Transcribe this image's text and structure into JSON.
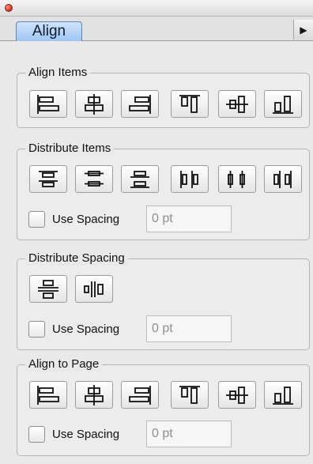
{
  "tab": {
    "label": "Align"
  },
  "panel_menu": {
    "label": "▶"
  },
  "align_items": {
    "title": "Align Items"
  },
  "distribute_items": {
    "title": "Distribute Items",
    "use_spacing_label": "Use Spacing",
    "spacing_value": "0 pt"
  },
  "distribute_spacing": {
    "title": "Distribute Spacing",
    "use_spacing_label": "Use Spacing",
    "spacing_value": "0 pt"
  },
  "align_to_page": {
    "title": "Align to Page",
    "use_spacing_label": "Use Spacing",
    "spacing_value": "0 pt"
  }
}
